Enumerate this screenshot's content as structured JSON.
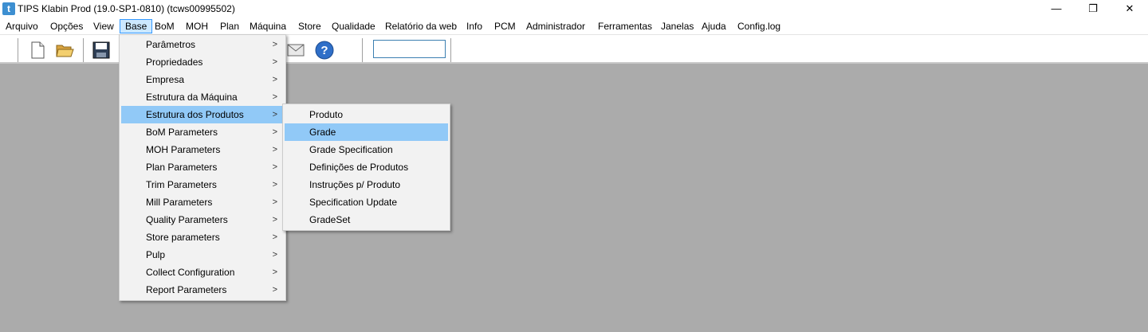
{
  "window": {
    "title": "TIPS Klabin Prod (19.0-SP1-0810) (tcws00995502)",
    "app_icon_letter": "t",
    "controls": {
      "minimize": "—",
      "maximize": "❐",
      "close": "✕"
    }
  },
  "menubar": {
    "items": [
      "Arquivo",
      "Opções",
      "View",
      "Base",
      "BoM",
      "MOH",
      "Plan",
      "Máquina",
      "Store",
      "Qualidade",
      "Relatório da web",
      "Info",
      "PCM",
      "Administrador",
      "Ferramentas",
      "Janelas",
      "Ajuda",
      "Config.log"
    ],
    "active": "Base"
  },
  "toolbar": {
    "icons": [
      "new-document-icon",
      "open-folder-icon",
      "save-disk-icon",
      "mail-envelope-icon",
      "help-icon"
    ],
    "search_value": ""
  },
  "base_menu": {
    "items": [
      {
        "label": "Parâmetros",
        "submenu": true
      },
      {
        "label": "Propriedades",
        "submenu": true
      },
      {
        "label": "Empresa",
        "submenu": true
      },
      {
        "label": "Estrutura da Máquina",
        "submenu": true
      },
      {
        "label": "Estrutura dos Produtos",
        "submenu": true,
        "highlighted": true
      },
      {
        "label": "BoM Parameters",
        "submenu": true
      },
      {
        "label": "MOH Parameters",
        "submenu": true
      },
      {
        "label": "Plan Parameters",
        "submenu": true
      },
      {
        "label": "Trim Parameters",
        "submenu": true
      },
      {
        "label": "Mill Parameters",
        "submenu": true
      },
      {
        "label": "Quality Parameters",
        "submenu": true
      },
      {
        "label": "Store parameters",
        "submenu": true
      },
      {
        "label": "Pulp",
        "submenu": true
      },
      {
        "label": "Collect Configuration",
        "submenu": true
      },
      {
        "label": "Report Parameters",
        "submenu": true
      }
    ],
    "arrow": ">"
  },
  "submenu_estrutura": {
    "items": [
      {
        "label": "Produto"
      },
      {
        "label": "Grade",
        "highlighted": true
      },
      {
        "label": "Grade Specification"
      },
      {
        "label": "Definições de Produtos"
      },
      {
        "label": "Instruções p/ Produto"
      },
      {
        "label": "Specification Update"
      },
      {
        "label": "GradeSet"
      }
    ]
  },
  "colors": {
    "workspace": "#ababab",
    "menu_bg": "#f2f2f2",
    "highlight": "#91c9f7",
    "active_menu_border": "#3399ff"
  }
}
